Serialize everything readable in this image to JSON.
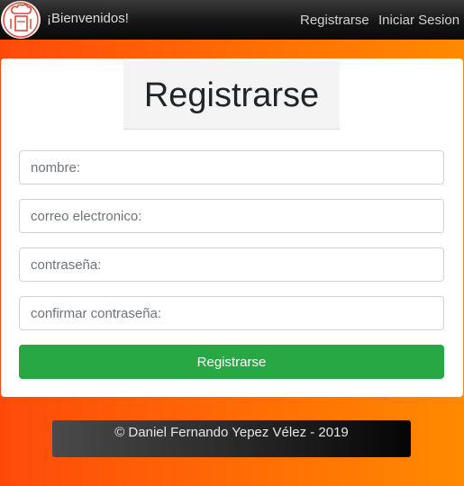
{
  "navbar": {
    "logo_icon": "chef-logo-icon",
    "brand": "¡Bienvenidos!",
    "links": {
      "register": "Registrarse",
      "login": "Iniciar Sesion"
    }
  },
  "form": {
    "title": "Registrarse",
    "fields": {
      "nombre": {
        "placeholder": "nombre:",
        "value": ""
      },
      "correo": {
        "placeholder": "correo electronico:",
        "value": ""
      },
      "password": {
        "placeholder": "contraseña:",
        "value": ""
      },
      "confirm": {
        "placeholder": "confirmar contraseña:",
        "value": ""
      }
    },
    "submit_label": "Registrarse"
  },
  "footer": {
    "text": "© Daniel Fernando Yepez Vélez - 2019"
  },
  "colors": {
    "navbar": "#151515",
    "background_start": "#ff4a0a",
    "background_end": "#ff8a00",
    "submit": "#28a745",
    "logo_accent": "#e0463b"
  }
}
